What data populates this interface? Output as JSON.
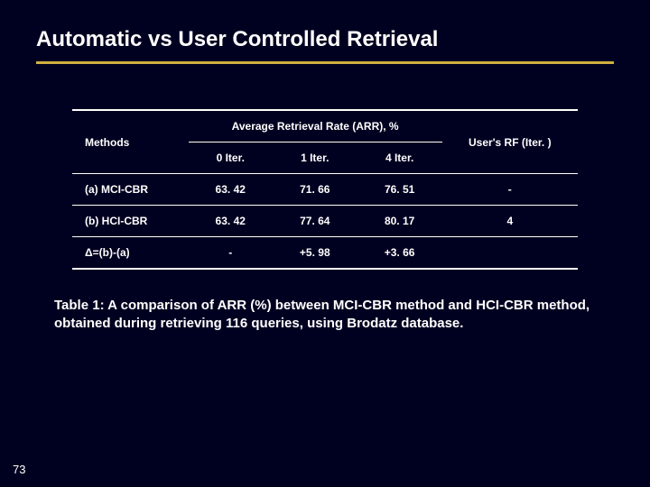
{
  "title": "Automatic vs User Controlled Retrieval",
  "page_number": "73",
  "chart_data": {
    "type": "table",
    "title": "Average Retrieval Rate (ARR), %",
    "header": {
      "methods": "Methods",
      "arr_span": "Average Retrieval Rate (ARR), %",
      "user_rf": "User's RF (Iter. )"
    },
    "subheader": [
      "0 Iter.",
      "1 Iter.",
      "4 Iter."
    ],
    "rows": [
      {
        "method": "(a) MCI-CBR",
        "iter0": "63. 42",
        "iter1": "71. 66",
        "iter4": "76. 51",
        "rf": "-"
      },
      {
        "method": "(b) HCI-CBR",
        "iter0": "63. 42",
        "iter1": "77. 64",
        "iter4": "80. 17",
        "rf": "4"
      },
      {
        "method": "Δ=(b)-(a)",
        "iter0": "-",
        "iter1": "+5. 98",
        "iter4": "+3. 66",
        "rf": ""
      }
    ]
  },
  "caption": "Table 1: A comparison of ARR (%) between MCI-CBR method and HCI-CBR method, obtained during retrieving 116 queries, using Brodatz database."
}
